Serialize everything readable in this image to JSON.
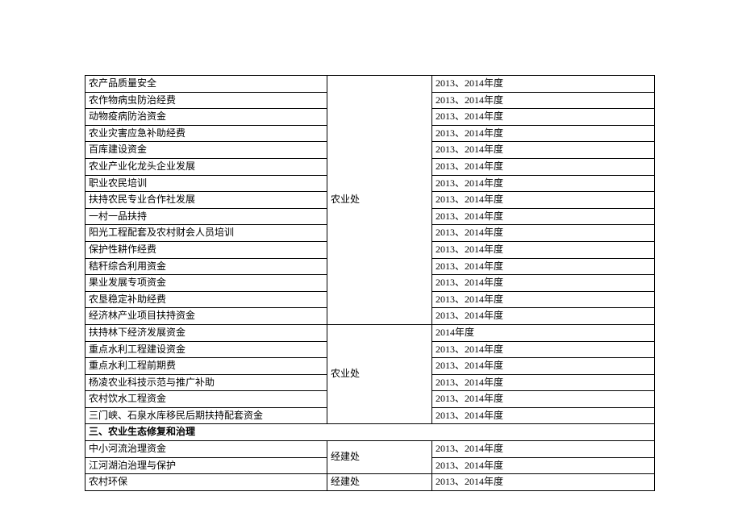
{
  "groups": [
    {
      "dept": "农业处",
      "rows": [
        {
          "name": "农产品质量安全",
          "year": "2013、2014年度"
        },
        {
          "name": "农作物病虫防治经费",
          "year": "2013、2014年度"
        },
        {
          "name": "动物疫病防治资金",
          "year": "2013、2014年度"
        },
        {
          "name": "农业灾害应急补助经费",
          "year": "2013、2014年度"
        },
        {
          "name": "百库建设资金",
          "year": "2013、2014年度"
        },
        {
          "name": "农业产业化龙头企业发展",
          "year": "2013、2014年度"
        },
        {
          "name": "职业农民培训",
          "year": "2013、2014年度"
        },
        {
          "name": "扶持农民专业合作社发展",
          "year": "2013、2014年度"
        },
        {
          "name": "一村一品扶持",
          "year": "2013、2014年度"
        },
        {
          "name": "阳光工程配套及农村财会人员培训",
          "year": "2013、2014年度"
        },
        {
          "name": "保护性耕作经费",
          "year": "2013、2014年度"
        },
        {
          "name": "秸秆综合利用资金",
          "year": "2013、2014年度"
        },
        {
          "name": "果业发展专项资金",
          "year": "2013、2014年度"
        },
        {
          "name": "农垦稳定补助经费",
          "year": "2013、2014年度"
        },
        {
          "name": "经济林产业项目扶持资金",
          "year": "2013、2014年度"
        }
      ]
    },
    {
      "dept": "农业处",
      "rows": [
        {
          "name": "扶持林下经济发展资金",
          "year": "2014年度"
        },
        {
          "name": "重点水利工程建设资金",
          "year": "2013、2014年度"
        },
        {
          "name": "重点水利工程前期费",
          "year": "2013、2014年度"
        },
        {
          "name": "杨凌农业科技示范与推广补助",
          "year": "2013、2014年度"
        },
        {
          "name": "农村饮水工程资金",
          "year": "2013、2014年度"
        },
        {
          "name": "三门峡、石泉水库移民后期扶持配套资金",
          "year": "2013、2014年度"
        }
      ]
    }
  ],
  "section_header": "三、农业生态修复和治理",
  "group3": {
    "dept": "经建处",
    "rows": [
      {
        "name": "中小河流治理资金",
        "year": "2013、2014年度"
      },
      {
        "name": "江河湖泊治理与保护",
        "year": "2013、2014年度"
      }
    ]
  },
  "group4": {
    "dept": "经建处",
    "rows": [
      {
        "name": "农村环保",
        "year": "2013、2014年度"
      }
    ]
  }
}
